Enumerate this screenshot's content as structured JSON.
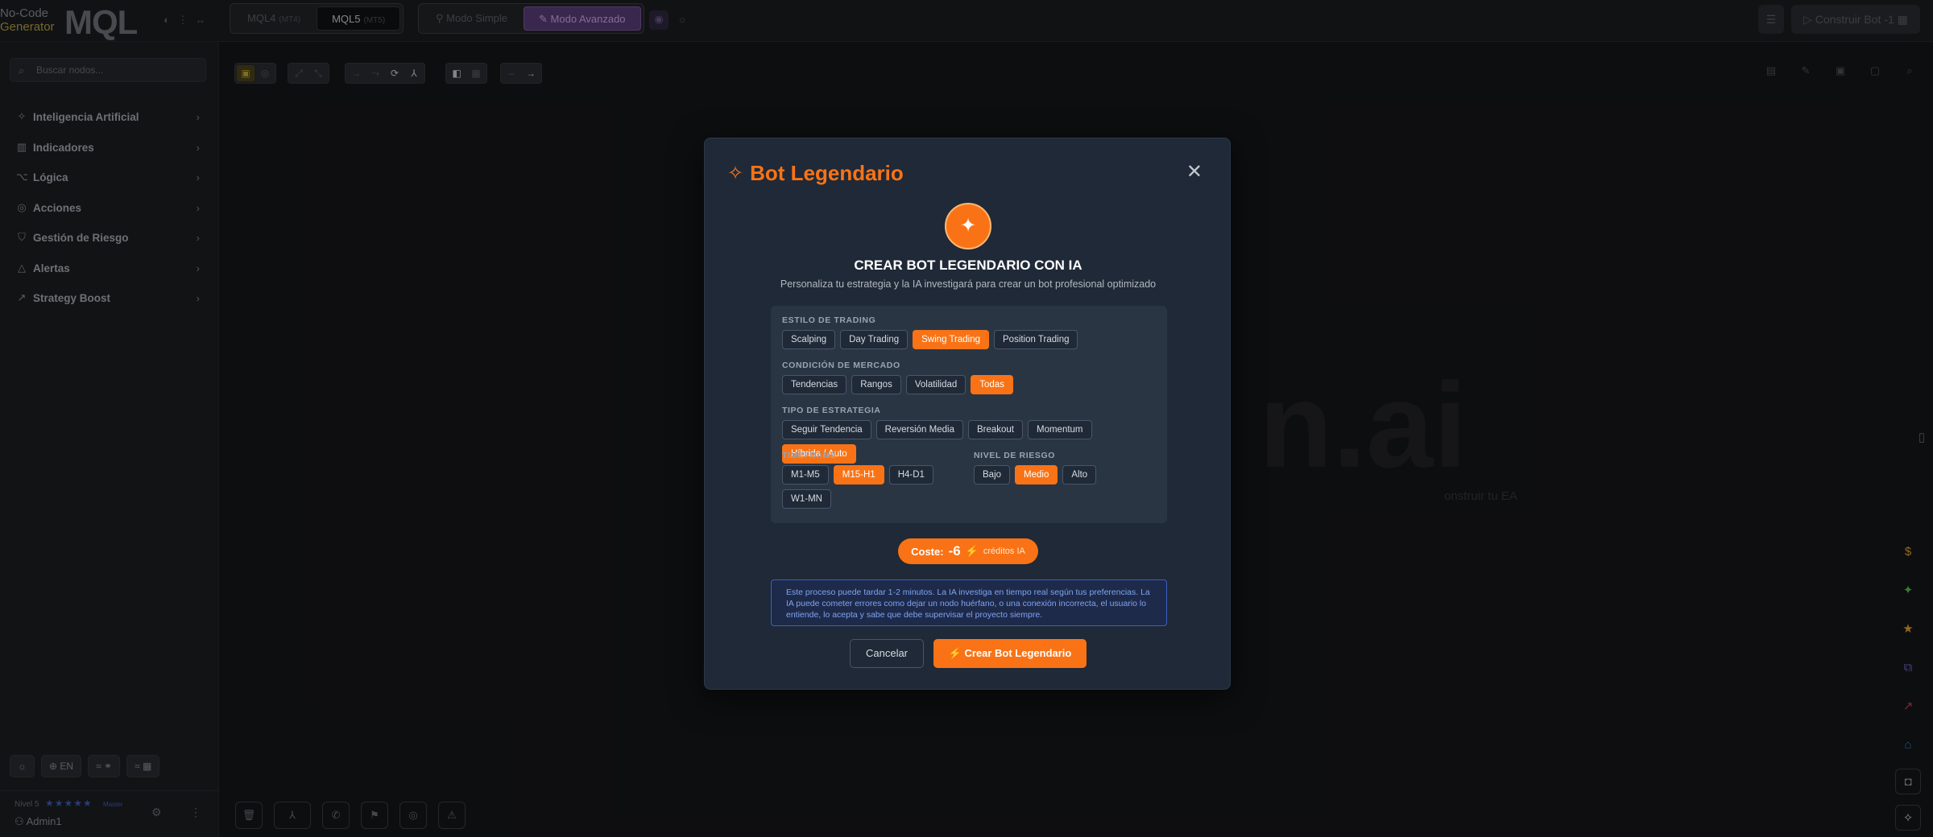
{
  "brand": {
    "line1": "No-Code",
    "line2": "Generator",
    "name": "MQL"
  },
  "platform_toggle": {
    "mql4": "MQL4",
    "mql4_tag": "(MT4)",
    "mql5": "MQL5",
    "mql5_tag": "(MT5)"
  },
  "mode_toggle": {
    "simple": "Modo Simple",
    "advanced": "Modo Avanzado"
  },
  "build_button": {
    "label": "Construir Bot",
    "cost": "-1"
  },
  "search": {
    "placeholder": "Buscar nodos..."
  },
  "sidebar": {
    "categories": [
      {
        "label": "Inteligencia Artificial",
        "icon": "brain-icon"
      },
      {
        "label": "Indicadores",
        "icon": "chart-icon"
      },
      {
        "label": "Lógica",
        "icon": "logic-icon"
      },
      {
        "label": "Acciones",
        "icon": "action-icon"
      },
      {
        "label": "Gestión de Riesgo",
        "icon": "shield-icon"
      },
      {
        "label": "Alertas",
        "icon": "warning-icon"
      },
      {
        "label": "Strategy Boost",
        "icon": "boost-icon"
      }
    ],
    "language": "EN",
    "user": {
      "level": "Nivel 5",
      "rank": "Master",
      "name": "Admin1",
      "stars": 5
    }
  },
  "canvas": {
    "watermark": "n.ai",
    "hint": "onstruir tu EA"
  },
  "modal": {
    "title": "Bot Legendario",
    "heading": "CREAR BOT LEGENDARIO CON IA",
    "subtitle": "Personaliza tu estrategia y la IA investigará para crear un bot profesional optimizado",
    "groups": {
      "style": {
        "label": "Estilo de Trading",
        "options": [
          "Scalping",
          "Day Trading",
          "Swing Trading",
          "Position Trading"
        ],
        "selected": "Swing Trading"
      },
      "market": {
        "label": "Condición de Mercado",
        "options": [
          "Tendencias",
          "Rangos",
          "Volatilidad",
          "Todas"
        ],
        "selected": "Todas"
      },
      "strategy": {
        "label": "Tipo de Estrategia",
        "options": [
          "Seguir Tendencia",
          "Reversión Media",
          "Breakout",
          "Momentum",
          "Híbrida / Auto"
        ],
        "selected": "Híbrida / Auto"
      },
      "timeframe": {
        "label": "Timeframe",
        "options": [
          "M1-M5",
          "M15-H1",
          "H4-D1",
          "W1-MN"
        ],
        "selected": "M15-H1"
      },
      "risk": {
        "label": "Nivel de Riesgo",
        "options": [
          "Bajo",
          "Medio",
          "Alto"
        ],
        "selected": "Medio"
      }
    },
    "cost": {
      "label": "Coste:",
      "value": "-6",
      "unit": "créditos IA"
    },
    "notice": "Este proceso puede tardar 1-2 minutos. La IA investiga en tiempo real según tus preferencias. La IA puede cometer errores como dejar un nodo huérfano, o una conexión incorrecta, el usuario lo entiende, lo acepta y sabe que debe supervisar el proyecto siempre.",
    "cancel": "Cancelar",
    "create": "Crear Bot Legendario"
  },
  "colors": {
    "accent": "#f97316",
    "modal_bg": "#1f2937",
    "notice_border": "#3b5fc4",
    "mode_active": "#5a3d78"
  }
}
